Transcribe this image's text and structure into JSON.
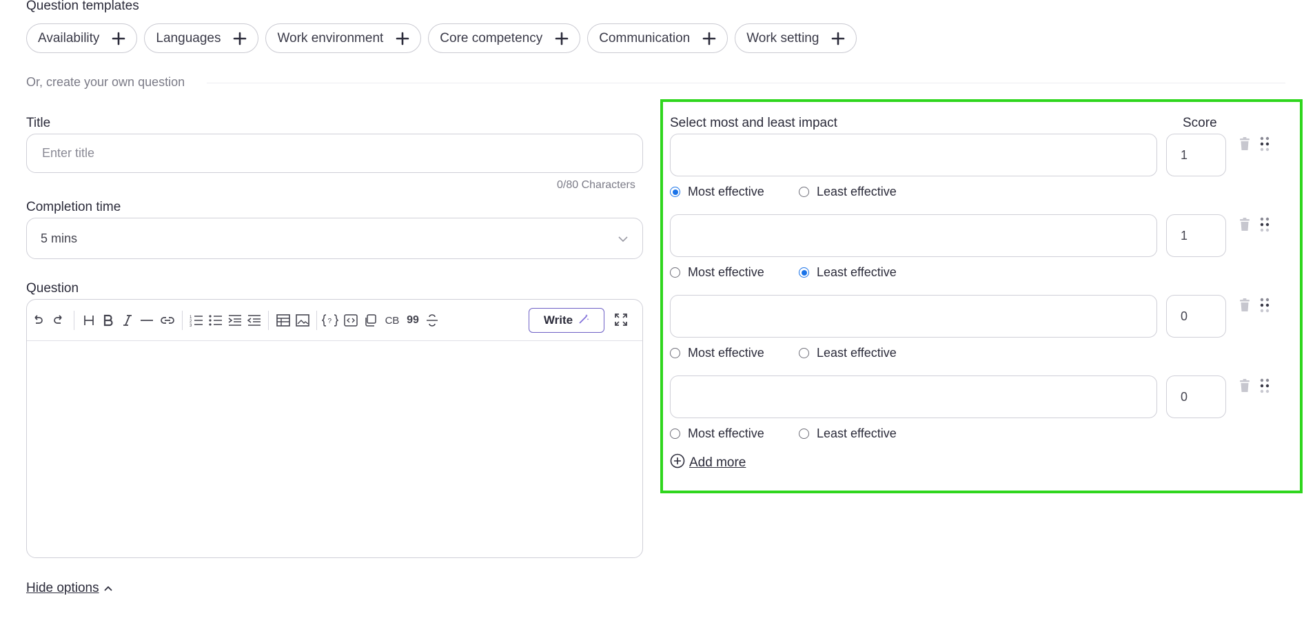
{
  "templates": {
    "heading": "Question templates",
    "chips": [
      "Availability",
      "Languages",
      "Work environment",
      "Core competency",
      "Communication",
      "Work setting"
    ]
  },
  "create_own": "Or, create your own question",
  "title_field": {
    "label": "Title",
    "placeholder": "Enter title",
    "counter": "0/80 Characters"
  },
  "completion": {
    "label": "Completion time",
    "value": "5 mins"
  },
  "question": {
    "label": "Question",
    "toolbar_text": {
      "cb": "CB",
      "quote": "99",
      "write": "Write"
    }
  },
  "hide_options": "Hide options",
  "impact_panel": {
    "heading": "Select most and least impact",
    "score_header": "Score",
    "most_label": "Most effective",
    "least_label": "Least effective",
    "options": [
      {
        "score": "1",
        "selected": "most"
      },
      {
        "score": "1",
        "selected": "least"
      },
      {
        "score": "0",
        "selected": "none"
      },
      {
        "score": "0",
        "selected": "none"
      }
    ],
    "add_more": "Add more"
  },
  "colors": {
    "highlight": "#2fd61d",
    "radio": "#1a73e8",
    "write_border": "#6d5fc5"
  }
}
